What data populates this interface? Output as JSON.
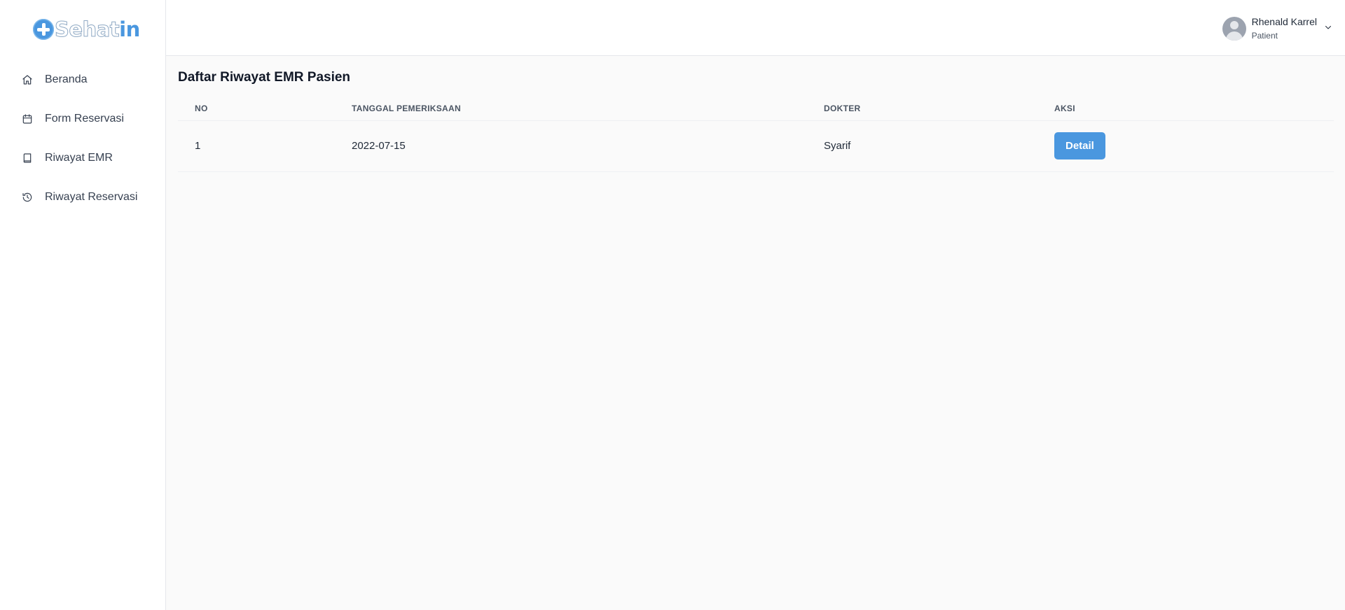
{
  "app": {
    "logo_part1": "Sehat",
    "logo_part2": "in"
  },
  "sidebar": {
    "items": [
      {
        "label": "Beranda",
        "icon": "home-icon"
      },
      {
        "label": "Form Reservasi",
        "icon": "calendar-icon"
      },
      {
        "label": "Riwayat EMR",
        "icon": "book-icon"
      },
      {
        "label": "Riwayat Reservasi",
        "icon": "history-icon"
      }
    ]
  },
  "header": {
    "user_name": "Rhenald Karrel",
    "user_role": "Patient"
  },
  "main": {
    "title": "Daftar Riwayat EMR Pasien",
    "table": {
      "columns": [
        "NO",
        "TANGGAL PEMERIKSAAN",
        "DOKTER",
        "AKSI"
      ],
      "rows": [
        {
          "no": "1",
          "date": "2022-07-15",
          "doctor": "Syarif",
          "action": "Detail"
        }
      ]
    }
  },
  "colors": {
    "accent": "#4a97df",
    "sidebar_bg": "#ffffff",
    "content_bg": "#fafafa"
  }
}
